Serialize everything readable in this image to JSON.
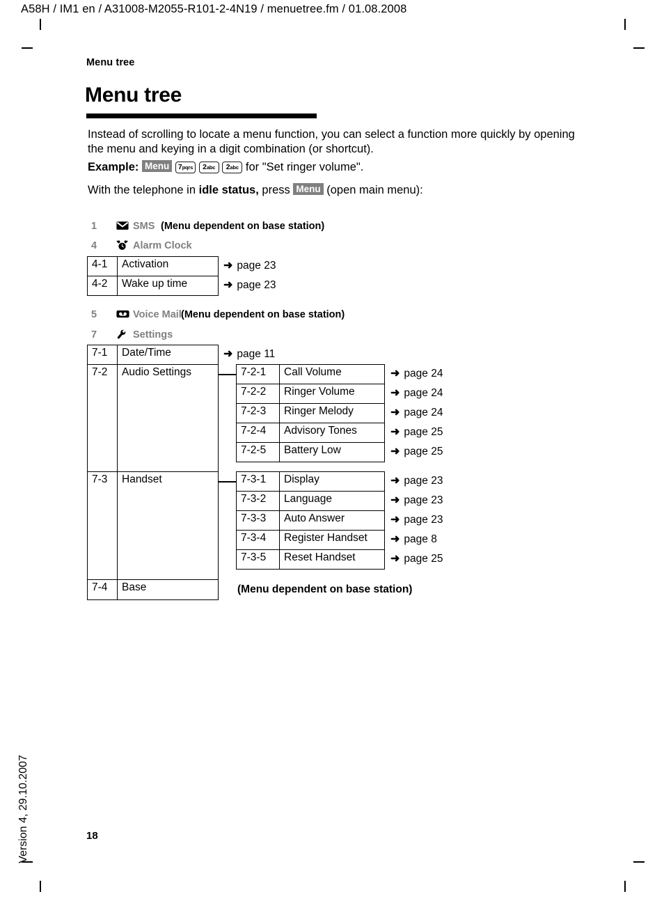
{
  "doc": {
    "header": "A58H / IM1 en / A31008-M2055-R101-2-4N19 / menuetree.fm / 01.08.2008",
    "running_head": "Menu tree",
    "chapter_title": "Menu tree",
    "page_number": "18",
    "version_footer": "Version 4, 29.10.2007"
  },
  "intro": {
    "paragraph": "Instead of scrolling to locate a menu function, you can select a function more quickly by opening the menu and keying in a digit combination (or shortcut).",
    "example_label": "Example:",
    "example_softkey": "Menu",
    "example_keys": [
      {
        "digit": "7",
        "letters": "pqrs"
      },
      {
        "digit": "2",
        "letters": "abc"
      },
      {
        "digit": "2",
        "letters": "abc"
      }
    ],
    "example_suffix": "for \"Set ringer volume\".",
    "press_prefix": "With the telephone in",
    "press_bold": "idle status,",
    "press_mid": "press",
    "press_softkey": "Menu",
    "press_suffix": "(open main menu):"
  },
  "base_station_note": "(Menu dependent on base station)",
  "menu_entries": [
    {
      "num": "1",
      "icon": "envelope-icon",
      "label": "SMS",
      "note": "(Menu dependent on base station)"
    },
    {
      "num": "4",
      "icon": "alarm-clock-icon",
      "label": "Alarm Clock",
      "note": ""
    },
    {
      "num": "5",
      "icon": "voice-mail-icon",
      "label": "Voice Mail",
      "note": "(Menu dependent on base station)"
    },
    {
      "num": "7",
      "icon": "wrench-icon",
      "label": "Settings",
      "note": ""
    }
  ],
  "alarm_rows": [
    {
      "code": "4-1",
      "label": "Activation",
      "page": "page 23"
    },
    {
      "code": "4-2",
      "label": "Wake up time",
      "page": "page 23"
    }
  ],
  "settings_rows": [
    {
      "code": "7-1",
      "label": "Date/Time",
      "page": "page 11"
    },
    {
      "code": "7-2",
      "label": "Audio Settings",
      "page": ""
    },
    {
      "code": "7-3",
      "label": "Handset",
      "page": ""
    },
    {
      "code": "7-4",
      "label": "Base",
      "page": ""
    }
  ],
  "audio_rows": [
    {
      "code": "7-2-1",
      "label": "Call Volume",
      "page": "page 24"
    },
    {
      "code": "7-2-2",
      "label": "Ringer Volume",
      "page": "page 24"
    },
    {
      "code": "7-2-3",
      "label": "Ringer Melody",
      "page": "page 24"
    },
    {
      "code": "7-2-4",
      "label": "Advisory Tones",
      "page": "page 25"
    },
    {
      "code": "7-2-5",
      "label": "Battery Low",
      "page": "page 25"
    }
  ],
  "handset_rows": [
    {
      "code": "7-3-1",
      "label": "Display",
      "page": "page 23"
    },
    {
      "code": "7-3-2",
      "label": "Language",
      "page": "page 23"
    },
    {
      "code": "7-3-3",
      "label": "Auto Answer",
      "page": "page 23"
    },
    {
      "code": "7-3-4",
      "label": "Register Handset",
      "page": "page 8"
    },
    {
      "code": "7-3-5",
      "label": "Reset Handset",
      "page": "page 25"
    }
  ],
  "arrow_glyph": "➜",
  "colors": {
    "gray_label": "#808080",
    "softkey_bg": "#808080",
    "text": "#000000"
  }
}
